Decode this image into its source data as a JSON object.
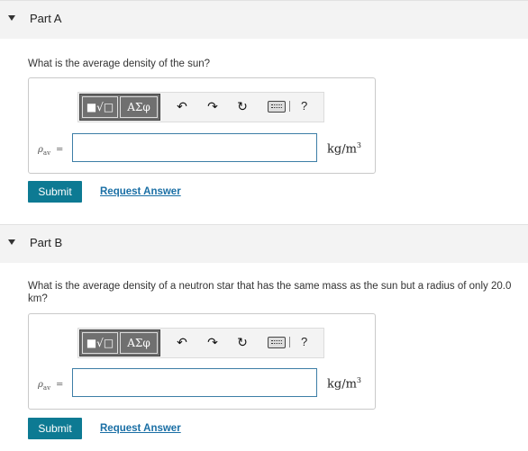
{
  "parts": [
    {
      "title": "Part A",
      "question": "What is the average density of the sun?",
      "toolbar": {
        "template_label": "■√□",
        "symbols_label": "ΑΣφ",
        "undo_glyph": "↶",
        "redo_glyph": "↷",
        "reset_glyph": "↻",
        "help_label": "?"
      },
      "variable": "ρ",
      "variable_sub": "av",
      "equals": "=",
      "answer_value": "",
      "unit": "kg/m",
      "unit_exp": "3",
      "submit_label": "Submit",
      "request_label": "Request Answer"
    },
    {
      "title": "Part B",
      "question": "What is the average density of a neutron star that has the same mass as the sun but a radius of only 20.0 km?",
      "toolbar": {
        "template_label": "■√□",
        "symbols_label": "ΑΣφ",
        "undo_glyph": "↶",
        "redo_glyph": "↷",
        "reset_glyph": "↻",
        "help_label": "?"
      },
      "variable": "ρ",
      "variable_sub": "av",
      "equals": "=",
      "answer_value": "",
      "unit": "kg/m",
      "unit_exp": "3",
      "submit_label": "Submit",
      "request_label": "Request Answer"
    }
  ]
}
